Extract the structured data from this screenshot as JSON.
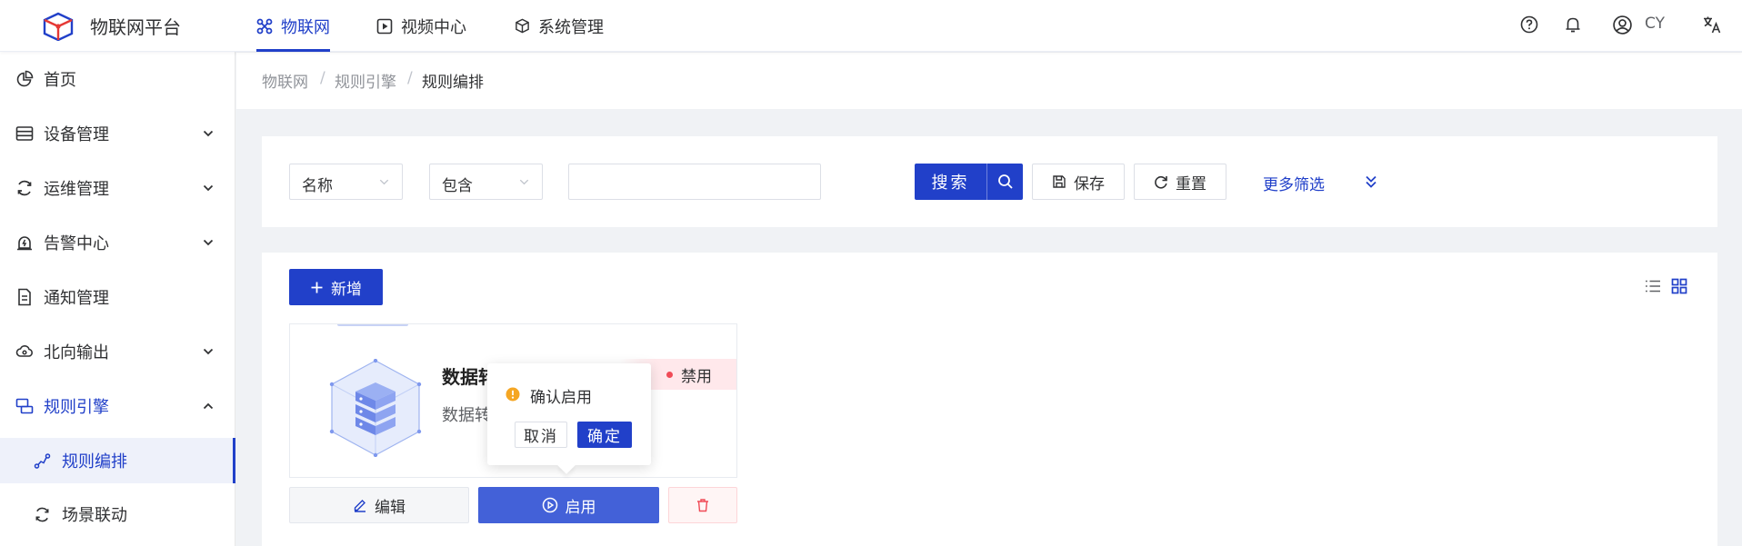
{
  "app": {
    "title": "物联网平台",
    "brand_color": "#2140c9"
  },
  "topnav": [
    {
      "label": "物联网",
      "icon": "iot-grid-icon",
      "active": true
    },
    {
      "label": "视频中心",
      "icon": "video-play-icon",
      "active": false
    },
    {
      "label": "系统管理",
      "icon": "cube-icon",
      "active": false
    }
  ],
  "topright": {
    "help_icon": "help-icon",
    "bell_icon": "bell-icon",
    "user_icon": "user-avatar-icon",
    "user_name": "CY",
    "lang_icon": "translate-icon"
  },
  "sidebar": {
    "items": [
      {
        "label": "首页",
        "icon": "pie-chart-icon",
        "has_arrow": false
      },
      {
        "label": "设备管理",
        "icon": "device-list-icon",
        "has_arrow": true
      },
      {
        "label": "运维管理",
        "icon": "ops-cycle-icon",
        "has_arrow": true
      },
      {
        "label": "告警中心",
        "icon": "alarm-icon",
        "has_arrow": true
      },
      {
        "label": "通知管理",
        "icon": "document-icon",
        "has_arrow": false
      },
      {
        "label": "北向输出",
        "icon": "cloud-output-icon",
        "has_arrow": true
      },
      {
        "label": "规则引擎",
        "icon": "rule-engine-icon",
        "has_arrow": true,
        "expanded": true
      }
    ],
    "subitems": [
      {
        "label": "规则编排",
        "icon": "flow-icon",
        "active": true
      },
      {
        "label": "场景联动",
        "icon": "linkage-icon",
        "active": false
      }
    ]
  },
  "breadcrumb": {
    "items": [
      "物联网",
      "规则引擎",
      "规则编排"
    ],
    "separator": "/"
  },
  "filter": {
    "field_select": "名称",
    "operator_select": "包含",
    "value": "",
    "search_label": "搜索",
    "save_label": "保存",
    "reset_label": "重置",
    "more_filter_label": "更多筛选"
  },
  "toolbar": {
    "add_label": "新增",
    "list_view_icon": "list-view-icon",
    "card_view_icon": "grid-view-icon"
  },
  "card": {
    "title": "数据转",
    "description": "数据转",
    "status": "禁用",
    "status_color": "#f04b57",
    "edit_label": "编辑",
    "enable_label": "启用",
    "delete_icon": "trash-icon"
  },
  "popconfirm": {
    "message": "确认启用",
    "cancel_label": "取消",
    "confirm_label": "确定",
    "warn_color": "#f5a623"
  }
}
